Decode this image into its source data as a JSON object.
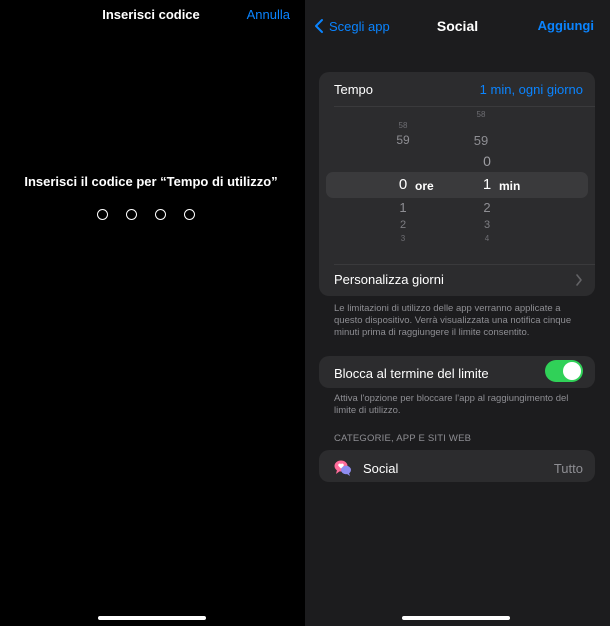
{
  "passcode": {
    "title": "Inserisci codice",
    "cancel": "Annulla",
    "prompt": "Inserisci il codice per “Tempo di utilizzo”"
  },
  "nav": {
    "back": "Scegli app",
    "title": "Social",
    "add": "Aggiungi"
  },
  "time": {
    "label": "Tempo",
    "value": "1 min, ogni giorno",
    "hours_unit": "ore",
    "minutes_unit": "min",
    "hours_selected": "0",
    "minutes_selected": "1",
    "hours_above": [
      "59",
      "58"
    ],
    "hours_below": [
      "1",
      "2",
      "3"
    ],
    "minutes_above": [
      "0"
    ],
    "minutes_below": [
      "2",
      "3",
      "4"
    ]
  },
  "customize_days": "Personalizza giorni",
  "note_limits": "Le limitazioni di utilizzo delle app verranno applicate a questo dispositivo. Verrà visualizzata una notifica cinque minuti prima di raggiungere il limite consentito.",
  "block": {
    "label": "Blocca al termine del limite",
    "enabled": true,
    "note": "Attiva l'opzione per bloccare l'app al raggiungimento del limite di utilizzo."
  },
  "section_header": "CATEGORIE, APP E SITI WEB",
  "category": {
    "name": "Social",
    "detail": "Tutto"
  },
  "colors": {
    "accent": "#0a84ff",
    "toggle_on": "#30d158",
    "card": "#2c2c2e",
    "background": "#1c1c1e"
  }
}
